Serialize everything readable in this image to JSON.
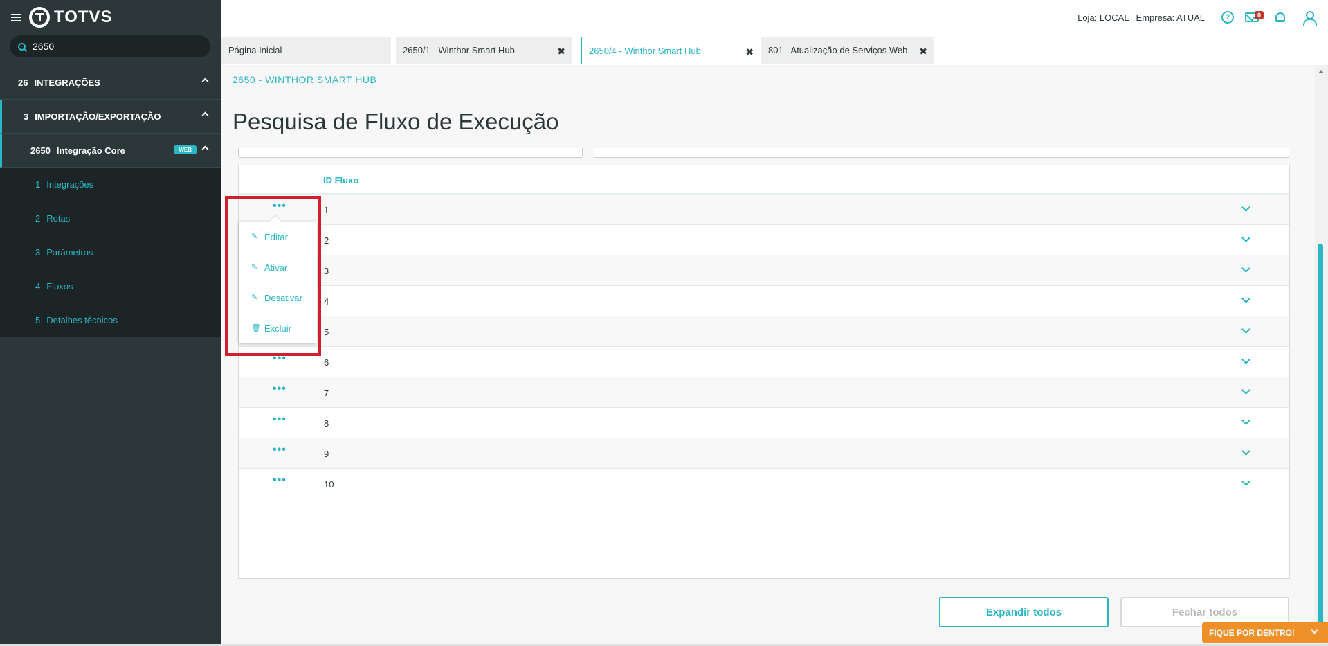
{
  "app": {
    "logo_text": "TOTVS"
  },
  "sidebar": {
    "search_value": "2650",
    "items": [
      {
        "num": "26",
        "label": "INTEGRAÇÕES"
      },
      {
        "num": "3",
        "label": "IMPORTAÇÃO/EXPORTAÇÃO"
      },
      {
        "num": "2650",
        "label": "Integração Core",
        "badge": "WEB"
      },
      {
        "num": "1",
        "label": "Integrações"
      },
      {
        "num": "2",
        "label": "Rotas"
      },
      {
        "num": "3",
        "label": "Parâmetros"
      },
      {
        "num": "4",
        "label": "Fluxos"
      },
      {
        "num": "5",
        "label": "Detalhes técnicos"
      }
    ]
  },
  "header": {
    "loja": "Loja: LOCAL",
    "empresa": "Empresa: ATUAL",
    "help_glyph": "?",
    "mail_count": "0"
  },
  "tabs": [
    {
      "label": "Página Inicial"
    },
    {
      "label": "2650/1 - Winthor Smart Hub",
      "close": "✖"
    },
    {
      "label": "2650/4 - Winthor Smart Hub",
      "close": "✖"
    },
    {
      "label": "801 - Atualização de Serviços Web",
      "close": "✖"
    }
  ],
  "page": {
    "breadcrumb": "2650 - WINTHOR SMART HUB",
    "title": "Pesquisa de Fluxo de Execução"
  },
  "table": {
    "column": "ID Fluxo",
    "rows": [
      "1",
      "2",
      "3",
      "4",
      "5",
      "6",
      "7",
      "8",
      "9",
      "10"
    ],
    "dots": "•••"
  },
  "popup": {
    "items": [
      "Editar",
      "Ativar",
      "Desativar",
      "Excluir"
    ]
  },
  "buttons": {
    "expand": "Expandir todos",
    "close": "Fechar todos"
  },
  "footer": {
    "fique": "FIQUE POR DENTRO!"
  },
  "colors": {
    "accent": "#29b6c5",
    "sidebar_bg": "#2c3739",
    "highlight": "#d0202e",
    "fique": "#ef8f27"
  }
}
